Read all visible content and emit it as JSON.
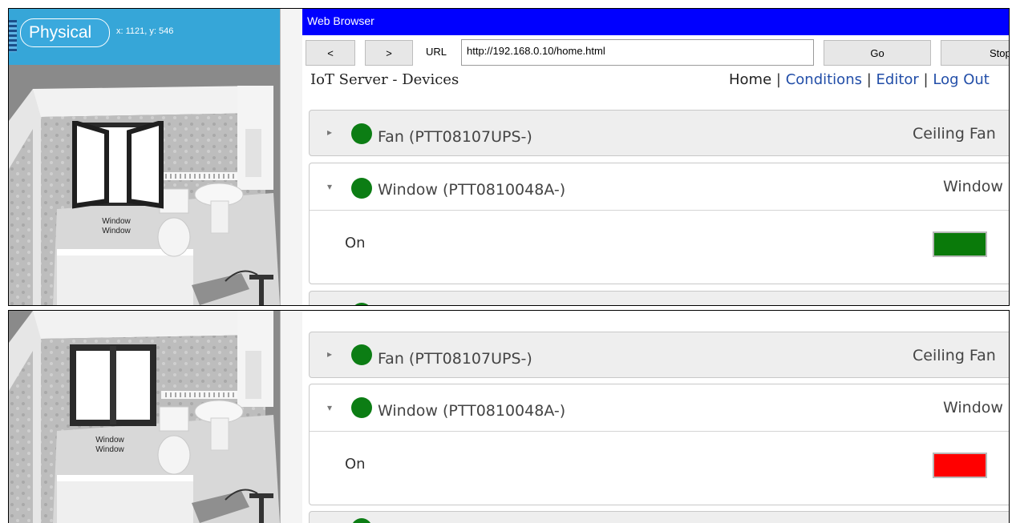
{
  "top_panel": {
    "physical_label": "Physical",
    "coordinates": "x: 1121, y: 546",
    "window_label_line1": "Window",
    "window_label_line2": "Window",
    "browser": {
      "title": "Web Browser",
      "back_label": "<",
      "forward_label": ">",
      "url_label": "URL",
      "url_value": "http://192.168.0.10/home.html",
      "go_label": "Go",
      "stop_label": "Stop",
      "page_heading": "IoT Server - Devices",
      "nav": {
        "home": "Home",
        "sep": "|",
        "conditions": "Conditions",
        "editor": "Editor",
        "logout": "Log Out"
      }
    },
    "devices": [
      {
        "name": "Fan (PTT08107UPS-)",
        "type": "Ceiling Fan",
        "status_color": "#0c7d14"
      },
      {
        "name": "Window (PTT0810048A-)",
        "type": "Window",
        "status_color": "#0c7d14",
        "state_label": "On",
        "state_color": "#0a7a0a"
      }
    ]
  },
  "bottom_panel": {
    "window_label_line1": "Window",
    "window_label_line2": "Window",
    "devices": [
      {
        "name": "Fan (PTT08107UPS-)",
        "type": "Ceiling Fan",
        "status_color": "#0c7d14"
      },
      {
        "name": "Window (PTT0810048A-)",
        "type": "Window",
        "status_color": "#0c7d14",
        "state_label": "On",
        "state_color": "#ff0000"
      }
    ]
  }
}
